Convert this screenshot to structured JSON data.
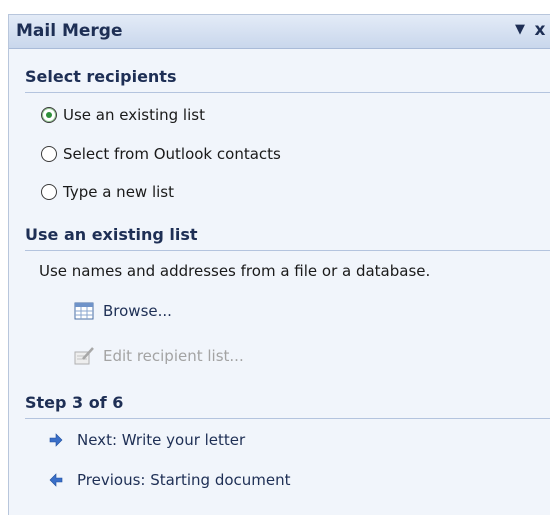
{
  "pane": {
    "title": "Mail Merge",
    "dropdown_glyph": "▼",
    "close_glyph": "x"
  },
  "select_recipients": {
    "heading": "Select recipients",
    "options": [
      {
        "label": "Use an existing list",
        "checked": true
      },
      {
        "label": "Select from Outlook contacts",
        "checked": false
      },
      {
        "label": "Type a new list",
        "checked": false
      }
    ]
  },
  "existing_list": {
    "heading": "Use an existing list",
    "description": "Use names and addresses from a file or a database.",
    "browse_label": "Browse...",
    "edit_label": "Edit recipient list..."
  },
  "step": {
    "heading": "Step 3 of 6",
    "next_label": "Next: Write your letter",
    "previous_label": "Previous: Starting document"
  },
  "icons": {
    "browse": "table-icon",
    "edit": "edit-list-icon",
    "next": "arrow-right-icon",
    "previous": "arrow-left-icon"
  },
  "colors": {
    "accent": "#1e2f55",
    "pane_bg": "#f1f5fb",
    "title_bg": "#c9d7ec",
    "radio_dot": "#2d8f3a",
    "disabled": "#a3a3a3",
    "arrow": "#3a6fc8"
  }
}
